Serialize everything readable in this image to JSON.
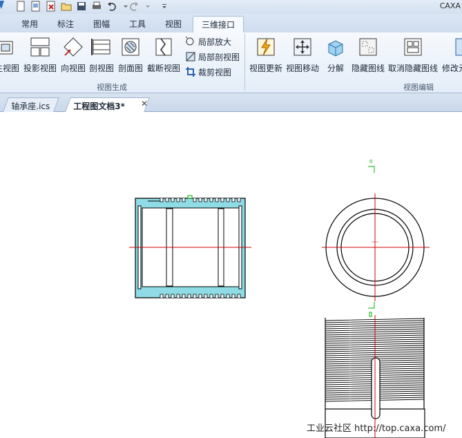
{
  "app": {
    "title": "CAXA"
  },
  "quick_access": {
    "icons": [
      "new-icon",
      "open-icon",
      "import-icon",
      "folder-icon",
      "save-icon",
      "print-icon",
      "undo-icon",
      "redo-icon",
      "customize-icon"
    ]
  },
  "tabs": [
    {
      "label": "常用"
    },
    {
      "label": "标注"
    },
    {
      "label": "图幅"
    },
    {
      "label": "工具"
    },
    {
      "label": "视图"
    },
    {
      "label": "三维接口",
      "active": true
    }
  ],
  "ribbon": {
    "view_generation": {
      "label": "视图生成",
      "buttons": [
        {
          "label": "生视图",
          "icon": "base-view-icon"
        },
        {
          "label": "投影视图",
          "icon": "projection-view-icon"
        },
        {
          "label": "向视图",
          "icon": "direction-view-icon"
        },
        {
          "label": "剖视图",
          "icon": "section-view-icon"
        },
        {
          "label": "剖面图",
          "icon": "cross-section-icon"
        },
        {
          "label": "截断视图",
          "icon": "break-view-icon"
        }
      ],
      "small_buttons": [
        {
          "label": "局部放大",
          "icon": "detail-view-icon"
        },
        {
          "label": "局部剖视图",
          "icon": "partial-section-icon"
        },
        {
          "label": "裁剪视图",
          "icon": "crop-view-icon"
        }
      ]
    },
    "view_edit": {
      "label": "视图编辑",
      "buttons": [
        {
          "label": "视图更新",
          "icon": "update-view-icon"
        },
        {
          "label": "视图移动",
          "icon": "move-view-icon"
        },
        {
          "label": "分解",
          "icon": "explode-icon"
        },
        {
          "label": "隐藏图线",
          "icon": "hide-lines-icon"
        },
        {
          "label": "取消隐藏图线",
          "icon": "show-lines-icon"
        },
        {
          "label": "修改元",
          "icon": "modify-icon"
        }
      ]
    }
  },
  "documents": [
    {
      "label": "轴承座.ics",
      "active": false
    },
    {
      "label": "工程图文档3*",
      "active": true
    }
  ],
  "canvas": {
    "marker_label": "0",
    "watermark": "工业云社区 http://top.caxa.com/"
  },
  "colors": {
    "centerline": "#cc0000",
    "section_hatch": "#8fdbe6",
    "outline": "#000000",
    "marker": "#00b000"
  }
}
